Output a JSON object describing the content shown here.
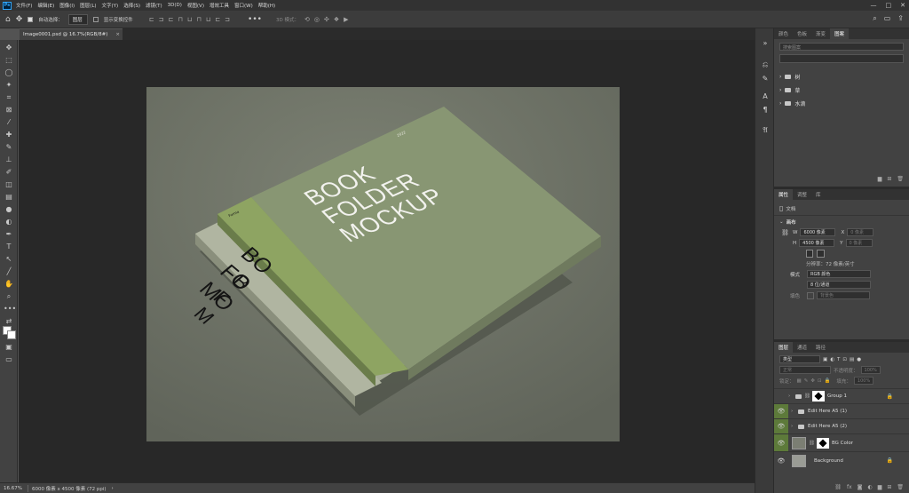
{
  "menubar": {
    "logo": "Ps",
    "items": [
      "文件(F)",
      "编辑(E)",
      "图像(I)",
      "图层(L)",
      "文字(Y)",
      "选择(S)",
      "滤镜(T)",
      "3D(D)",
      "视图(V)",
      "增效工具",
      "窗口(W)",
      "帮助(H)"
    ],
    "minimize": "—",
    "maximize": "□",
    "close": "✕"
  },
  "options": {
    "auto_select_label": "自动选择：",
    "auto_select_value": "图层",
    "transform_label": "显示变换控件",
    "mode_label": "3D 模式："
  },
  "document": {
    "tab_title": "Image0001.psd @ 16.7%(RGB/8#)",
    "close": "×"
  },
  "status": {
    "zoom": "16.67%",
    "dimensions": "6000 像素 x 4500 像素 (72 ppi)"
  },
  "mockup": {
    "title_line1": "BOOK",
    "title_line2": "FOLDER",
    "title_line3": "MOCKUP",
    "back_line1": "BO",
    "back_line2": "FO",
    "back_line3": "MO",
    "far_line1": "B",
    "far_line2": "F",
    "far_line3": "M",
    "brand_small": "Forma",
    "year_small": "2022"
  },
  "libraries": {
    "tabs": [
      "颜色",
      "色板",
      "渐变",
      "图案"
    ],
    "active_tab": "图案",
    "search_placeholder": "搜索图案",
    "items": [
      "树",
      "草",
      "水滴"
    ]
  },
  "properties": {
    "tabs": [
      "属性",
      "调整",
      "库"
    ],
    "doc_label": "文档",
    "canvas_label": "画布",
    "w_label": "W",
    "w_value": "6000 像素",
    "h_label": "H",
    "h_value": "4500 像素",
    "x_label": "X",
    "x_value": "0 像素",
    "y_label": "Y",
    "y_value": "0 像素",
    "resolution": "分辨率：72 像素/英寸",
    "mode_label": "模式",
    "mode_value": "RGB 颜色",
    "depth_value": "8 位/通道",
    "fill_label": "填色",
    "fill_value": "背景色"
  },
  "layers": {
    "tabs": [
      "图层",
      "通道",
      "路径"
    ],
    "filter_label": "类型",
    "blend_mode": "正常",
    "opacity_label": "不透明度：",
    "opacity_value": "100%",
    "lock_label": "锁定：",
    "fill_label": "填充：",
    "fill_value": "100%",
    "items": [
      {
        "name": "Group 1",
        "visible": false
      },
      {
        "name": "Edit Here A5 (1)",
        "visible": true
      },
      {
        "name": "Edit Here A5 (2)",
        "visible": true
      },
      {
        "name": "BG Color",
        "visible": true
      },
      {
        "name": "Background",
        "visible": false
      }
    ]
  }
}
